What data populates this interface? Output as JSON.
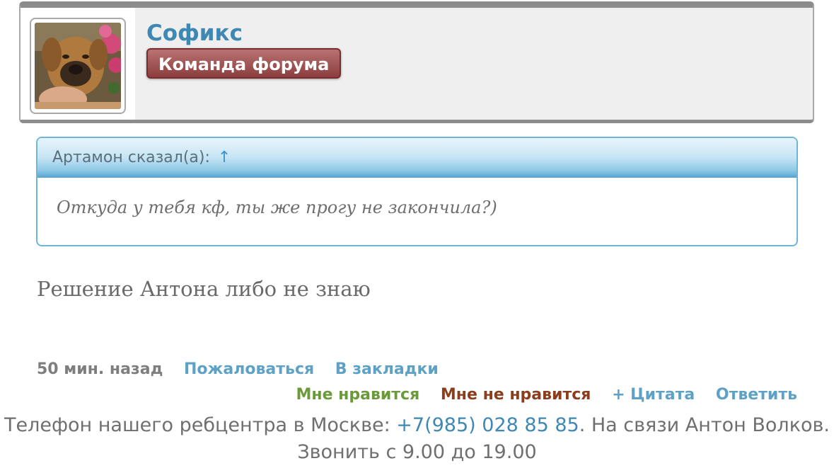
{
  "user": {
    "name": "Софикс",
    "role_badge": "Команда форума",
    "avatar": "dog-photo-avatar"
  },
  "quote": {
    "header": "Артамон сказал(а):",
    "arrow": "↑",
    "text": "Откуда у тебя кф, ты же прогу не закончила?)"
  },
  "message": {
    "text": "Решение Антона либо не знаю"
  },
  "meta": {
    "time": "50 мин. назад",
    "report": "Пожаловаться",
    "bookmark": "В закладки"
  },
  "actions": {
    "like": "Мне нравится",
    "dislike": "Мне не нравится",
    "quote": "+ Цитата",
    "reply": "Ответить"
  },
  "footer": {
    "before_phone": "Телефон нашего ребцентра в Москве: ",
    "phone": "+7(985) 028 85 85",
    "after_phone": ". На связи Антон Волков. Звонить с 9.00 до 19.00"
  },
  "colors": {
    "link": "#3f88b3",
    "badge": "#9a4a4a",
    "quote_border": "#6eb6d8",
    "like": "#6a9a3a",
    "dislike": "#8a3e1e"
  }
}
